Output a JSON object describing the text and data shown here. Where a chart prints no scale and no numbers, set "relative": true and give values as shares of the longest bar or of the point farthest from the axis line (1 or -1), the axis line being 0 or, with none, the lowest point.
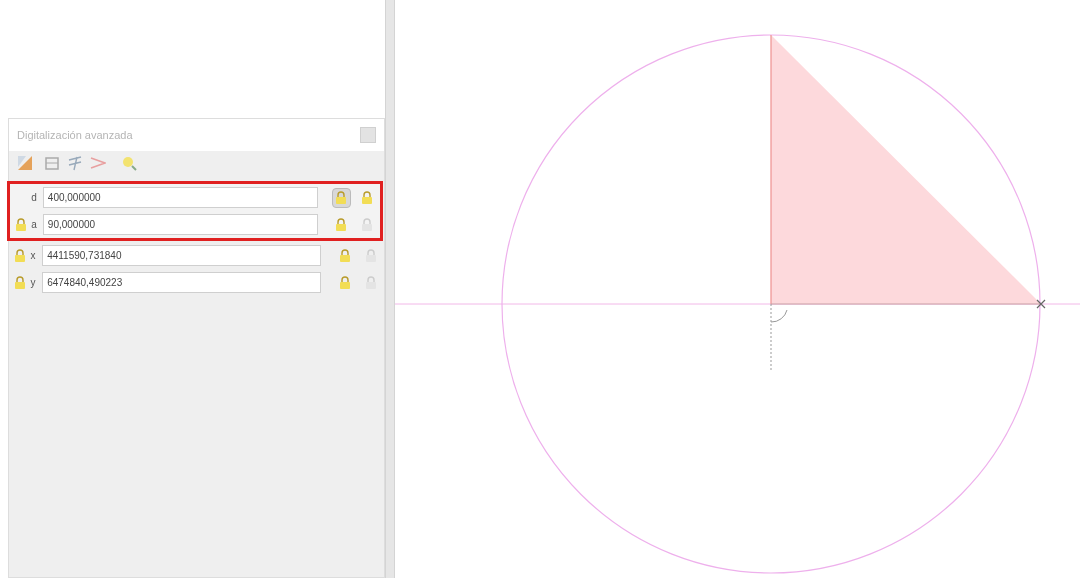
{
  "panel": {
    "title": "Digitalización avanzada",
    "fields": [
      {
        "label": "d",
        "value": "400,000000",
        "locked": false,
        "lock_pressed": true,
        "relative": true,
        "highlighted": true
      },
      {
        "label": "a",
        "value": "90,000000",
        "locked": true,
        "lock_pressed": false,
        "relative": false,
        "highlighted": true
      },
      {
        "label": "x",
        "value": "4411590,731840",
        "locked": true,
        "lock_pressed": false,
        "relative": false,
        "highlighted": false
      },
      {
        "label": "y",
        "value": "6474840,490223",
        "locked": true,
        "lock_pressed": false,
        "relative": false,
        "highlighted": false
      }
    ]
  }
}
